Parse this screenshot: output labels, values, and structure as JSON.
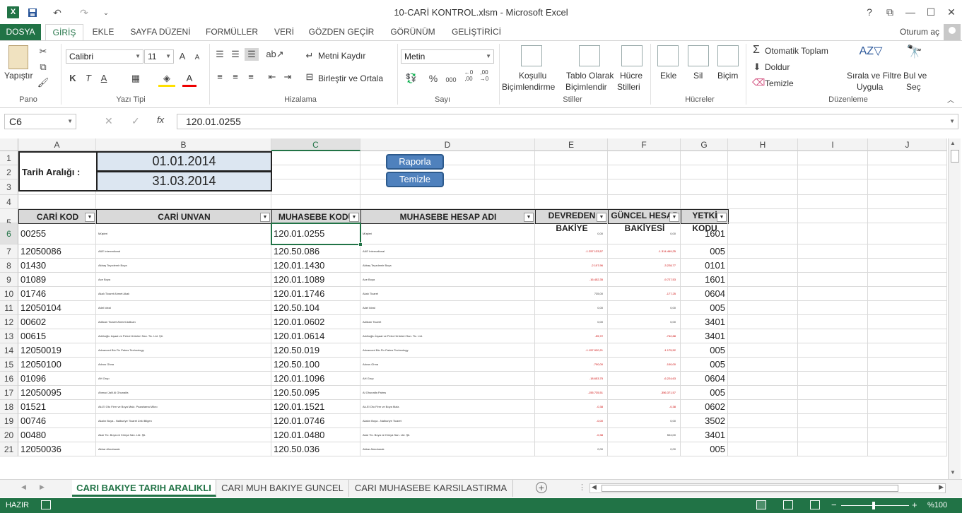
{
  "window": {
    "title": "10-CARİ KONTROL.xlsm - Microsoft Excel",
    "help": "?",
    "restore_ribbon": "⧉",
    "minimize": "—",
    "maximize": "☐",
    "close": "✕"
  },
  "qat": {
    "save": "💾",
    "undo": "↶",
    "redo": "↷",
    "customize": "⌄"
  },
  "ribbon_tabs": [
    "DOSYA",
    "GİRİŞ",
    "EKLE",
    "SAYFA DÜZENİ",
    "FORMÜLLER",
    "VERİ",
    "GÖZDEN GEÇİR",
    "GÖRÜNÜM",
    "GELİŞTİRİCİ"
  ],
  "account": {
    "login": "Oturum aç"
  },
  "ribbon": {
    "clipboard": {
      "paste": "Yapıştır",
      "label": "Pano"
    },
    "font": {
      "name": "Calibri",
      "size": "11",
      "bold": "K",
      "italic": "T",
      "underline": "A",
      "grow": "A",
      "shrink": "A",
      "font_color": "A",
      "label": "Yazı Tipi"
    },
    "alignment": {
      "wrap": "Metni Kaydır",
      "merge": "Birleştir ve Ortala",
      "label": "Hizalama"
    },
    "number": {
      "format": "Metin",
      "percent": "%",
      "comma": "000",
      "inc": "←0 ,00",
      "dec": ",00 →0",
      "label": "Sayı"
    },
    "styles": {
      "cond1": "Koşullu",
      "cond2": "Biçimlendirme",
      "table1": "Tablo Olarak",
      "table2": "Biçimlendir",
      "cell1": "Hücre",
      "cell2": "Stilleri",
      "label": "Stiller"
    },
    "cells": {
      "insert": "Ekle",
      "delete": "Sil",
      "format": "Biçim",
      "label": "Hücreler"
    },
    "editing": {
      "autosum": "Otomatik Toplam",
      "fill": "Doldur",
      "clear": "Temizle",
      "sort1": "Sırala ve Filtre",
      "sort2": "Uygula",
      "find1": "Bul ve",
      "find2": "Seç",
      "label": "Düzenleme"
    }
  },
  "formula_bar": {
    "name_box": "C6",
    "fx": "fx",
    "value": "120.01.0255"
  },
  "columns": [
    "A",
    "B",
    "C",
    "D",
    "E",
    "F",
    "G",
    "H",
    "I",
    "J"
  ],
  "row_numbers": [
    "1",
    "2",
    "3",
    "4",
    "5",
    "6",
    "7",
    "8",
    "9",
    "10",
    "11",
    "12",
    "13",
    "14",
    "15",
    "16",
    "17",
    "18",
    "19",
    "20",
    "21"
  ],
  "header_block": {
    "date_label": "Tarih Aralığı :",
    "date_start": "01.01.2014",
    "date_end": "31.03.2014",
    "report_button": "Raporla",
    "clear_button": "Temizle"
  },
  "table_headers": {
    "cari_kod": "CARİ KOD",
    "cari_unvan": "CARİ UNVAN",
    "muhasebe_kodu": "MUHASEBE KODU",
    "muhasebe_hesap_adi": "MUHASEBE HESAP ADI",
    "devreden_1": "DEVREDEN",
    "devreden_2": "BAKİYE",
    "guncel_1": "GÜNCEL HESAP",
    "guncel_2": "BAKİYESİ",
    "yetki_1": "YETKİ",
    "yetki_2": "KODU"
  },
  "rows": [
    {
      "kod": "00255",
      "unvan": "Müşteri",
      "muh": "120.01.0255",
      "hesap": "Müşteri",
      "dev": "0,00",
      "gun": "0,00",
      "yetki": "1601"
    },
    {
      "kod": "12050086",
      "unvan": "A&E International",
      "muh": "120.50.086",
      "hesap": "A&E International",
      "dev": "-1.257.133,57",
      "gun": "-1.314.469,25",
      "yetki": "005"
    },
    {
      "kod": "01430",
      "unvan": "Akbaş Teyzdemir Boya",
      "muh": "120.01.1430",
      "hesap": "Akbaş Teyzdemir Boya",
      "dev": "-2.107,96",
      "gun": "-3.228,77",
      "yetki": "0101"
    },
    {
      "kod": "01089",
      "unvan": "Ace Boya",
      "muh": "120.01.1089",
      "hesap": "Ace Boya",
      "dev": "-16.452,35",
      "gun": "-9.727,53",
      "yetki": "1601"
    },
    {
      "kod": "01746",
      "unvan": "Akalı Ticaret Ahmet Akalı",
      "muh": "120.01.1746",
      "hesap": "Akalı Ticaret",
      "dev": "735,00",
      "gun": "-177,25",
      "yetki": "0604"
    },
    {
      "kod": "12050104",
      "unvan": "Adel Ideal",
      "muh": "120.50.104",
      "hesap": "Adel Ideal",
      "dev": "0,00",
      "gun": "0,00",
      "yetki": "005"
    },
    {
      "kod": "00602",
      "unvan": "Adilcan Ticaret Ahmet Adilcan",
      "muh": "120.01.0602",
      "hesap": "Adilcan Ticaret",
      "dev": "0,00",
      "gun": "0,00",
      "yetki": "3401"
    },
    {
      "kod": "00615",
      "unvan": "Adıllıoğlu Inşaat ve Petrol Ürünleri San. Tic. Ltd. Şti.",
      "muh": "120.01.0614",
      "hesap": "Adıllıoğlu İnşaat ve Petrol Ürünleri San. Tic. Ltd.",
      "dev": "-55,72",
      "gun": "-742,88",
      "yetki": "3401"
    },
    {
      "kod": "12050019",
      "unvan": "Advanced Bio Fix Palms Technology",
      "muh": "120.50.019",
      "hesap": "Advanced Bio Fix Palms Technology",
      "dev": "-1.157.920,21",
      "gun": "-1.175,52",
      "yetki": "005"
    },
    {
      "kod": "12050100",
      "unvan": "Advus Ghna",
      "muh": "120.50.100",
      "hesap": "Advus Ghna",
      "dev": "-700,00",
      "gun": "-100,00",
      "yetki": "005"
    },
    {
      "kod": "01096",
      "unvan": "AH Grup",
      "muh": "120.01.1096",
      "hesap": "AH Grup",
      "dev": "-18.653,75",
      "gun": "-6.224,63",
      "yetki": "0604"
    },
    {
      "kod": "12050095",
      "unvan": "Ahmad Jalil Al Ghunaifa",
      "muh": "120.50.095",
      "hesap": "Al Ghunaifa Palms",
      "dev": "-155.735,51",
      "gun": "-356.371,57",
      "yetki": "005"
    },
    {
      "kod": "01521",
      "unvan": "Ak-El Oto Firm ve Boya Malz. Pazarlama Mikro",
      "muh": "120.01.1521",
      "hesap": "Ak-El Oto Firm ve Boya Malz.",
      "dev": "-0,38",
      "gun": "-0,38",
      "yetki": "0602"
    },
    {
      "kod": "00746",
      "unvan": "Akalın Boya - Nalburiye Ticaret Zeki Bilgen",
      "muh": "120.01.0746",
      "hesap": "Akalın Boya - Nalburiye Ticaret",
      "dev": "-0,00",
      "gun": "0,00",
      "yetki": "3502"
    },
    {
      "kod": "00480",
      "unvan": "Akar Tic. Boya ve Kimya San. Ltd. Şti.",
      "muh": "120.01.0480",
      "hesap": "Akar Tic. Boya ve Kimya San. Ltd. Şti.",
      "dev": "-0,38",
      "gun": "504,00",
      "yetki": "3401"
    },
    {
      "kod": "12050036",
      "unvan": "Akbar Almubarak",
      "muh": "120.50.036",
      "hesap": "Akbar Almubarak",
      "dev": "0,00",
      "gun": "0,00",
      "yetki": "005"
    }
  ],
  "sheets": [
    "CARI BAKIYE TARIH ARALIKLI",
    "CARI MUH BAKIYE GUNCEL",
    "CARI MUHASEBE KARSILASTIRMA"
  ],
  "status": {
    "ready": "HAZIR",
    "zoom": "%100",
    "zoom_minus": "−",
    "zoom_plus": "+"
  }
}
